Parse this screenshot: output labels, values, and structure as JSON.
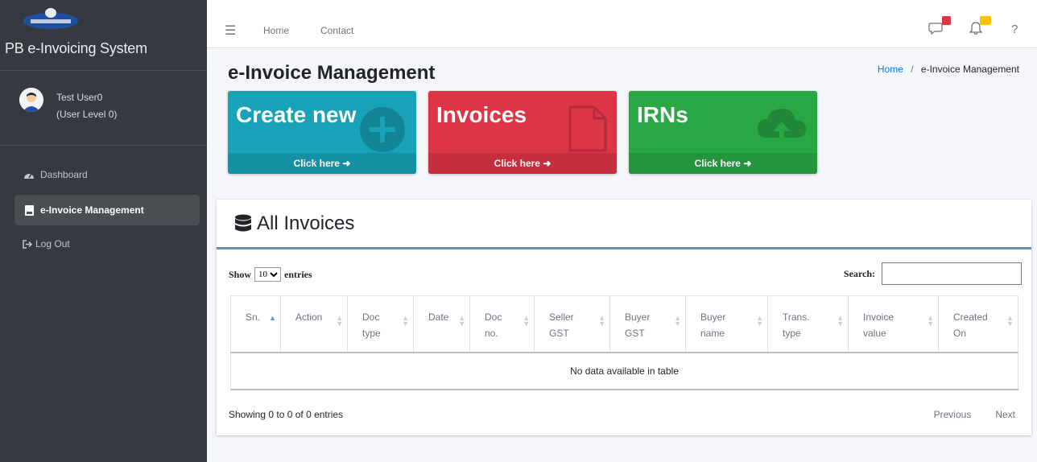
{
  "app": {
    "brand_name": "PB e-Invoicing System"
  },
  "user": {
    "name": "Test User0",
    "level": "(User Level 0)"
  },
  "sidebar": {
    "items": [
      {
        "label": "Dashboard",
        "icon": "dashboard-icon"
      },
      {
        "label": "e-Invoice Management",
        "icon": "file-icon",
        "active": true
      },
      {
        "label": "Log Out",
        "icon": "logout-icon"
      }
    ]
  },
  "topbar": {
    "links": [
      "Home",
      "Contact"
    ],
    "icons": [
      "comments-icon",
      "bell-icon",
      "help-icon"
    ],
    "help_label": "?"
  },
  "page": {
    "title": "e-Invoice Management",
    "breadcrumb": [
      "Home",
      "e-Invoice Management"
    ],
    "breadcrumb_separator": "/"
  },
  "boxes": [
    {
      "title": "Create new",
      "footer": "Click here",
      "color": "#17a2b8"
    },
    {
      "title": "Invoices",
      "footer": "Click here",
      "color": "#dc3545"
    },
    {
      "title": "IRNs",
      "footer": "Click here",
      "color": "#28a745"
    }
  ],
  "invoices": {
    "title": "All Invoices",
    "show_label": "Show",
    "entries_label": "entries",
    "page_size": "10",
    "search_label": "Search:",
    "columns": [
      [
        "Sn."
      ],
      [
        "Action"
      ],
      [
        "Doc",
        "type"
      ],
      [
        "Date"
      ],
      [
        "Doc",
        "no."
      ],
      [
        "Seller",
        "GST"
      ],
      [
        "Buyer",
        "GST"
      ],
      [
        "Buyer",
        "name"
      ],
      [
        "Trans.",
        "type"
      ],
      [
        "Invoice",
        "value"
      ],
      [
        "Created",
        "On"
      ]
    ],
    "empty_message": "No data available in table",
    "info": "Showing 0 to 0 of 0 entries",
    "prev_label": "Previous",
    "next_label": "Next"
  }
}
